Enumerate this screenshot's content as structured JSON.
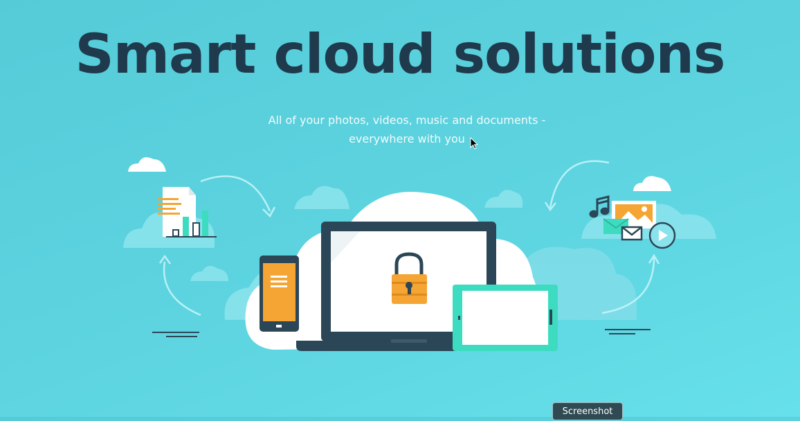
{
  "hero": {
    "title": "Smart cloud solutions",
    "subtitle_line1": "All of your photos, videos, music and documents -",
    "subtitle_line2": "everywhere with you"
  },
  "tooltip": {
    "label": "Screenshot"
  },
  "colors": {
    "background": "#5dd4e0",
    "title": "#1e3a4c",
    "accent_orange": "#f4a533",
    "accent_teal": "#3ddcc0",
    "device_dark": "#2b4656"
  },
  "icons": [
    "cloud-icon",
    "document-chart-icon",
    "lock-icon",
    "music-note-icon",
    "image-icon",
    "mail-icon",
    "play-icon",
    "smartphone-icon",
    "laptop-icon",
    "tablet-icon",
    "cursor-icon"
  ]
}
